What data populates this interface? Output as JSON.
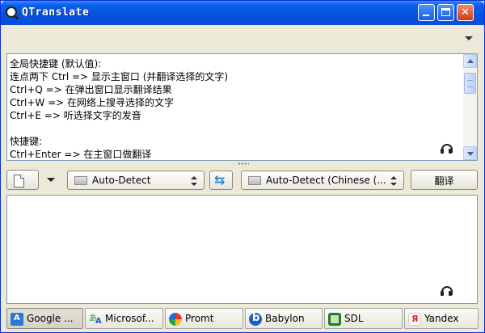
{
  "window": {
    "title": "QTranslate",
    "buttons": {
      "minimize": "minimize",
      "maximize": "maximize",
      "close": "close"
    }
  },
  "source": {
    "text": "全局快捷键 (默认值):\n连点两下 Ctrl => 显示主窗口 (并翻译选择的文字)\nCtrl+Q => 在弹出窗口显示翻译结果\nCtrl+W => 在网络上搜寻选择的文字\nCtrl+E => 听选择文字的发音\n\n快捷键:\nCtrl+Enter => 在主窗口做翻译"
  },
  "toolbar": {
    "source_language": "Auto-Detect",
    "target_language": "Auto-Detect (Chinese (...",
    "translate_label": "翻译"
  },
  "tabs": [
    {
      "label": "Google ...",
      "icon": "google-translate-icon",
      "active": true
    },
    {
      "label": "Microsof...",
      "icon": "microsoft-translator-icon"
    },
    {
      "label": "Promt",
      "icon": "promt-icon"
    },
    {
      "label": "Babylon",
      "icon": "babylon-icon"
    },
    {
      "label": "SDL",
      "icon": "sdl-icon"
    },
    {
      "label": "Yandex",
      "icon": "yandex-icon"
    }
  ],
  "colors": {
    "titlebar": "#0552e0",
    "window_bg": "#ece9d8",
    "close_button": "#d43a12",
    "swap_icon": "#1a8bd6"
  }
}
